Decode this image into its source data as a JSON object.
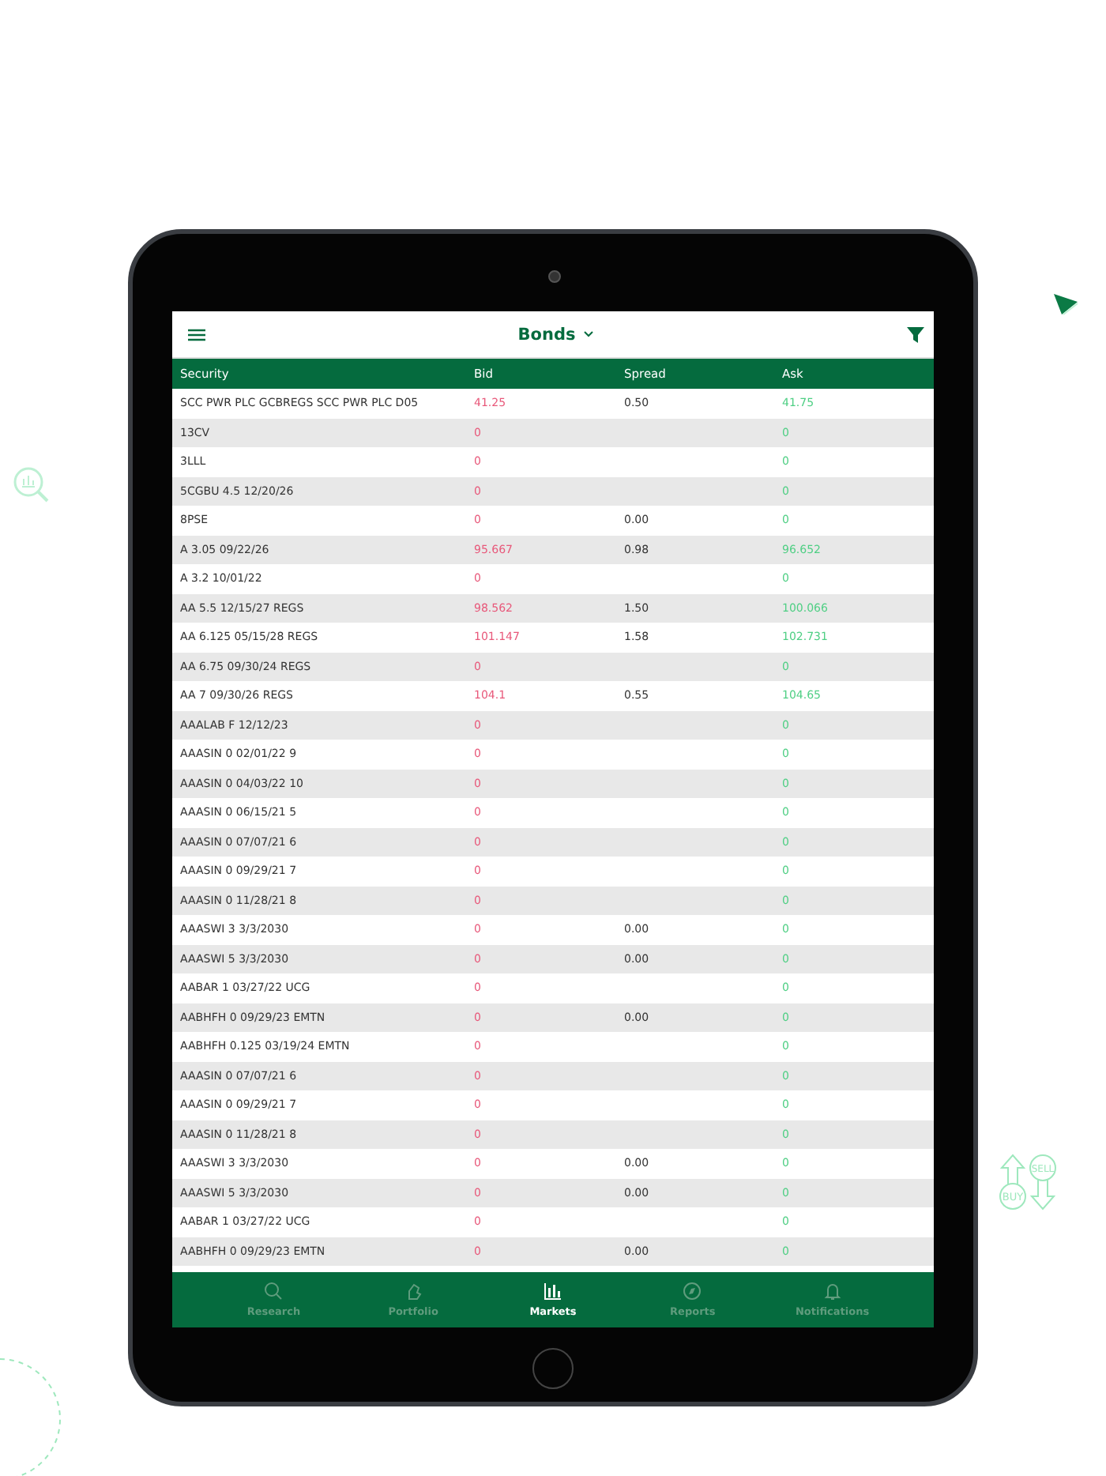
{
  "header": {
    "title": "Bonds"
  },
  "table": {
    "columns": [
      "Security",
      "Bid",
      "Spread",
      "Ask"
    ],
    "rows": [
      {
        "security": "SCC PWR PLC GCBREGS SCC PWR PLC D05",
        "bid": "41.25",
        "spread": "0.50",
        "ask": "41.75"
      },
      {
        "security": "13CV",
        "bid": "0",
        "ask": "0"
      },
      {
        "security": "3LLL",
        "bid": "0",
        "ask": "0"
      },
      {
        "security": "5CGBU 4.5 12/20/26",
        "bid": "0",
        "ask": "0"
      },
      {
        "security": "8PSE",
        "bid": "0",
        "spread": "0.00",
        "ask": "0"
      },
      {
        "security": "A 3.05 09/22/26",
        "bid": "95.667",
        "spread": "0.98",
        "ask": "96.652"
      },
      {
        "security": "A 3.2 10/01/22",
        "bid": "0",
        "ask": "0"
      },
      {
        "security": "AA 5.5 12/15/27 REGS",
        "bid": "98.562",
        "spread": "1.50",
        "ask": "100.066"
      },
      {
        "security": "AA 6.125 05/15/28 REGS",
        "bid": "101.147",
        "spread": "1.58",
        "ask": "102.731"
      },
      {
        "security": "AA 6.75 09/30/24 REGS",
        "bid": "0",
        "ask": "0"
      },
      {
        "security": "AA 7 09/30/26 REGS",
        "bid": "104.1",
        "spread": "0.55",
        "ask": "104.65"
      },
      {
        "security": "AAALAB F 12/12/23",
        "bid": "0",
        "ask": "0"
      },
      {
        "security": "AAASIN 0 02/01/22 9",
        "bid": "0",
        "ask": "0"
      },
      {
        "security": "AAASIN 0 04/03/22 10",
        "bid": "0",
        "ask": "0"
      },
      {
        "security": "AAASIN 0 06/15/21 5",
        "bid": "0",
        "ask": "0"
      },
      {
        "security": "AAASIN 0 07/07/21 6",
        "bid": "0",
        "ask": "0"
      },
      {
        "security": "AAASIN 0 09/29/21 7",
        "bid": "0",
        "ask": "0"
      },
      {
        "security": "AAASIN 0 11/28/21 8",
        "bid": "0",
        "ask": "0"
      },
      {
        "security": "AAASWI 3 3/3/2030",
        "bid": "0",
        "spread": "0.00",
        "ask": "0"
      },
      {
        "security": "AAASWI 5 3/3/2030",
        "bid": "0",
        "spread": "0.00",
        "ask": "0"
      },
      {
        "security": "AABAR 1 03/27/22 UCG",
        "bid": "0",
        "ask": "0"
      },
      {
        "security": "AABHFH 0 09/29/23 EMTN",
        "bid": "0",
        "spread": "0.00",
        "ask": "0"
      },
      {
        "security": "AABHFH 0.125 03/19/24 EMTN",
        "bid": "0",
        "ask": "0"
      },
      {
        "security": "AAASIN 0 07/07/21 6",
        "bid": "0",
        "ask": "0"
      },
      {
        "security": "AAASIN 0 09/29/21 7",
        "bid": "0",
        "ask": "0"
      },
      {
        "security": "AAASIN 0 11/28/21 8",
        "bid": "0",
        "ask": "0"
      },
      {
        "security": "AAASWI 3 3/3/2030",
        "bid": "0",
        "spread": "0.00",
        "ask": "0"
      },
      {
        "security": "AAASWI 5 3/3/2030",
        "bid": "0",
        "spread": "0.00",
        "ask": "0"
      },
      {
        "security": "AABAR 1 03/27/22 UCG",
        "bid": "0",
        "ask": "0"
      },
      {
        "security": "AABHFH 0 09/29/23 EMTN",
        "bid": "0",
        "spread": "0.00",
        "ask": "0"
      }
    ]
  },
  "tab_bar": [
    {
      "label": "Research",
      "kind": "research",
      "selected": false
    },
    {
      "label": "Portfolio",
      "kind": "portfolio",
      "selected": false
    },
    {
      "label": "Markets",
      "kind": "markets",
      "selected": true
    },
    {
      "label": "Reports",
      "kind": "reports",
      "selected": false
    },
    {
      "label": "Notifications",
      "kind": "notifications",
      "selected": false
    }
  ],
  "badges": {
    "buy": "BUY",
    "sell": "SELL"
  }
}
